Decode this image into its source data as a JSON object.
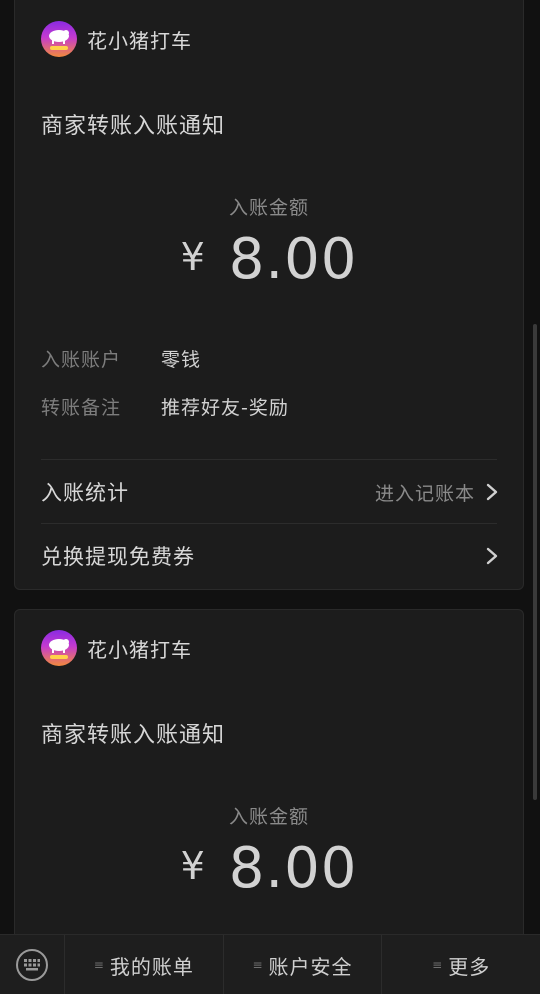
{
  "cards": [
    {
      "merchant": "花小猪打车",
      "title": "商家转账入账通知",
      "amount_label": "入账金额",
      "currency": "¥",
      "amount": "8.00",
      "details": [
        {
          "key": "入账账户",
          "value": "零钱"
        },
        {
          "key": "转账备注",
          "value": "推荐好友-奖励"
        }
      ],
      "links": [
        {
          "label": "入账统计",
          "hint": "进入记账本"
        },
        {
          "label": "兑换提现免费券",
          "hint": ""
        }
      ]
    },
    {
      "merchant": "花小猪打车",
      "title": "商家转账入账通知",
      "amount_label": "入账金额",
      "currency": "¥",
      "amount": "8.00"
    }
  ],
  "bottom_menu": {
    "keyboard_icon": "keyboard-icon",
    "items": [
      {
        "label": "我的账单"
      },
      {
        "label": "账户安全"
      },
      {
        "label": "更多"
      }
    ]
  },
  "colors": {
    "background": "#111111",
    "card": "#1c1c1c",
    "logo_gradient": [
      "#8a2be2",
      "#c43ad0",
      "#f28a3c"
    ]
  }
}
